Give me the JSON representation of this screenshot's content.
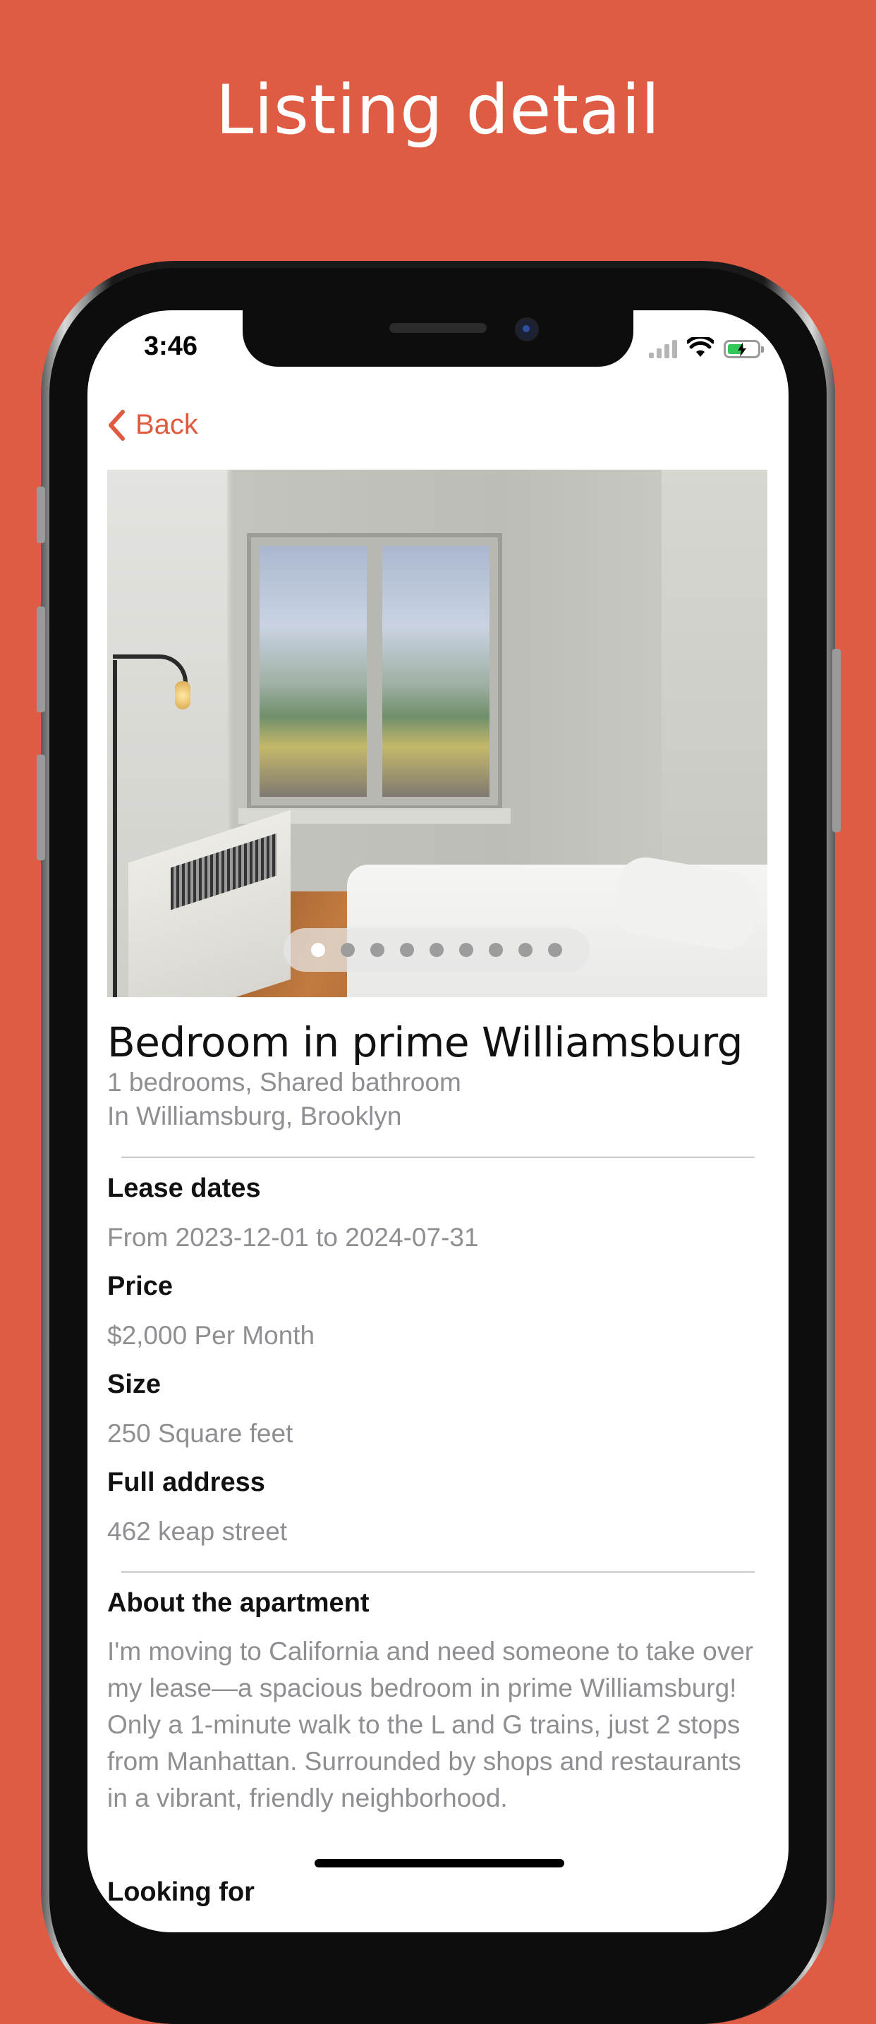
{
  "banner": {
    "title": "Listing detail"
  },
  "status_bar": {
    "time": "3:46"
  },
  "nav": {
    "back_label": "Back"
  },
  "gallery": {
    "photo_count": 9,
    "active_index": 0
  },
  "listing": {
    "title": "Bedroom in prime Williamsburg",
    "rooms": "1  bedrooms,  Shared  bathroom",
    "area": "In Williamsburg, Brooklyn"
  },
  "details": [
    {
      "label": "Lease dates",
      "value": "From 2023-12-01 to 2024-07-31"
    },
    {
      "label": "Price",
      "value": "$2,000 Per Month"
    },
    {
      "label": "Size",
      "value": "250 Square feet"
    },
    {
      "label": "Full address",
      "value": "462 keap street"
    }
  ],
  "about": {
    "label": "About the apartment",
    "text": "I'm moving to California and need someone to take over my lease—a spacious bedroom in prime Williamsburg! Only a 1-minute walk to the L and G trains, just 2 stops from Manhattan. Surrounded by shops and restaurants in a vibrant, friendly neighborhood."
  },
  "next_section_peek": "Looking for",
  "colors": {
    "brand": "#DF5B43",
    "accent_text": "#E05A40",
    "secondary_text": "#8e8e93"
  }
}
